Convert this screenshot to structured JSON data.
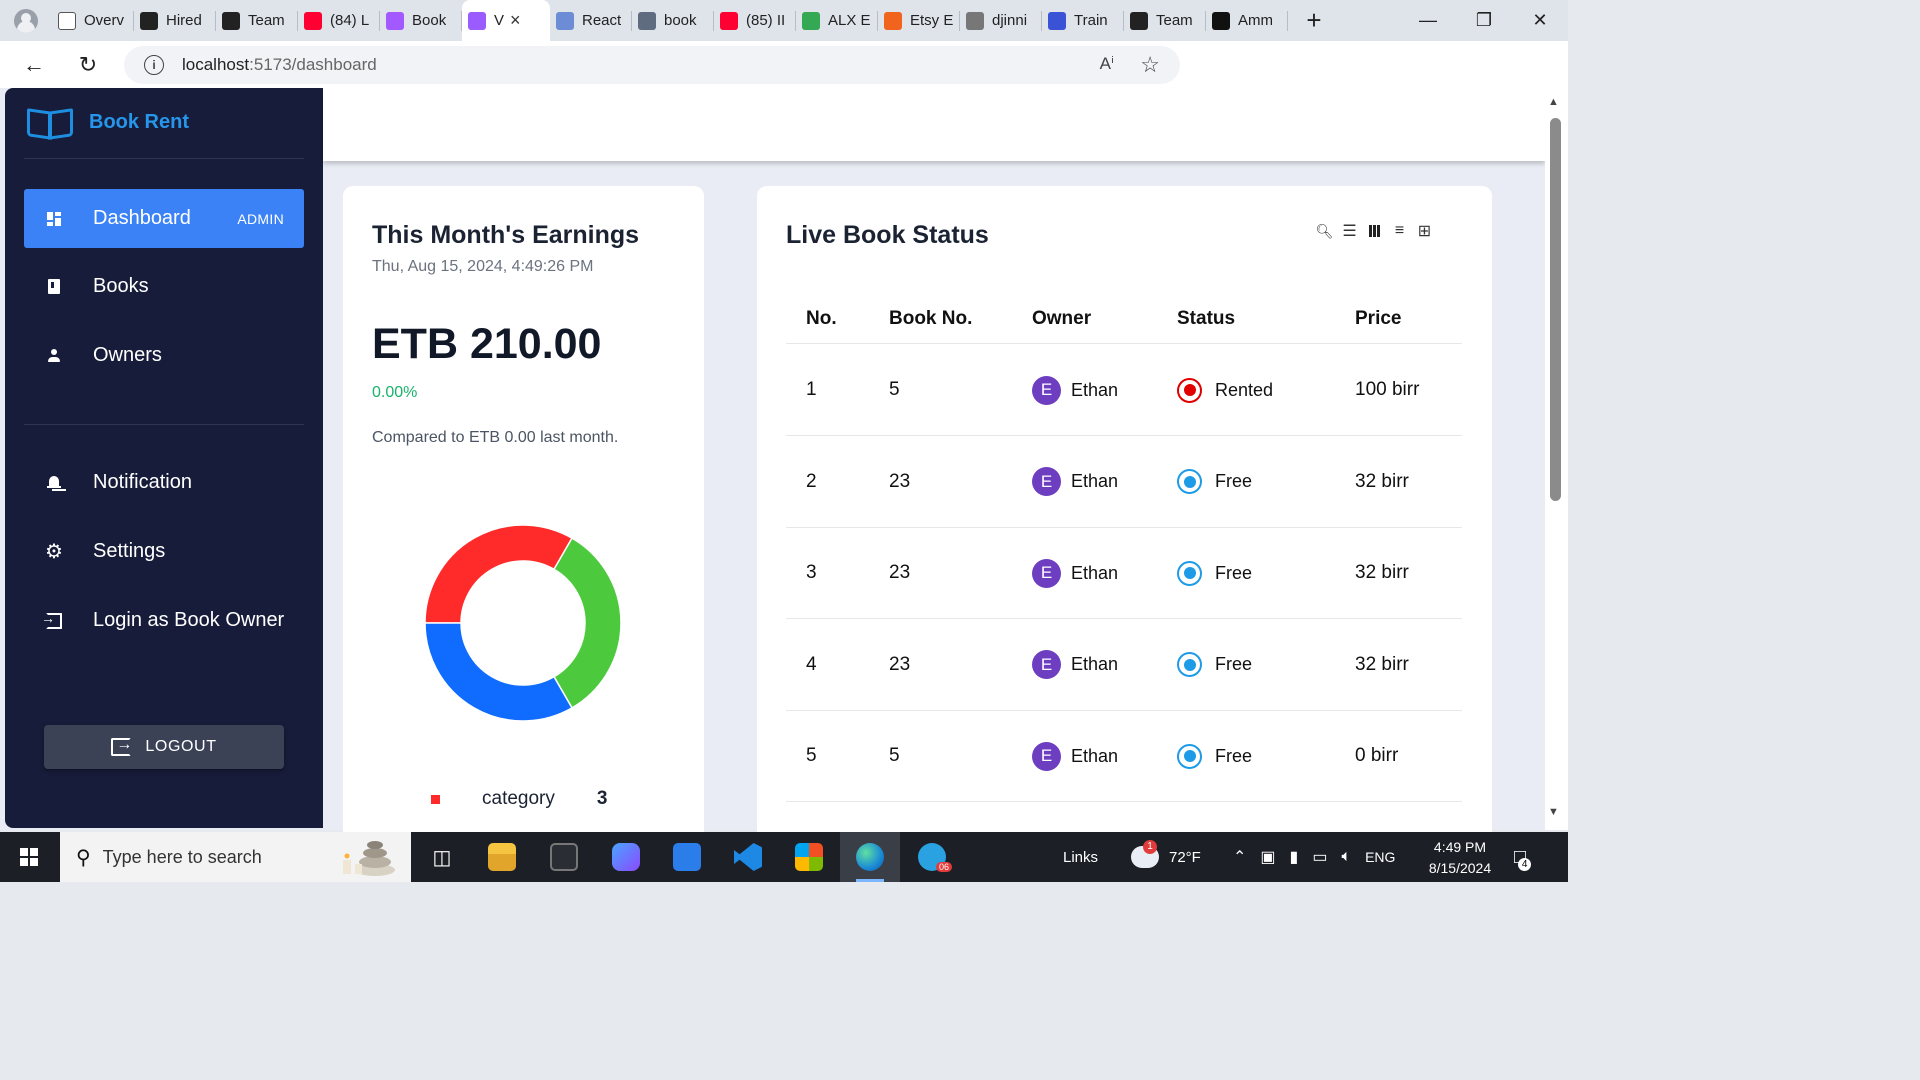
{
  "browser": {
    "tabs": [
      {
        "title": "Overv",
        "icon": "doc-icon",
        "color": "#ffffff"
      },
      {
        "title": "Hired",
        "icon": "openai-icon",
        "color": "#222222"
      },
      {
        "title": "Team",
        "icon": "spark-icon",
        "color": "#222222"
      },
      {
        "title": "(84) L",
        "icon": "youtube-icon",
        "color": "#ff0033"
      },
      {
        "title": "Book",
        "icon": "figma-icon",
        "color": "#a259ff"
      },
      {
        "title": "V",
        "icon": "vite-icon",
        "color": "#9b5cff",
        "active": true
      },
      {
        "title": "React",
        "icon": "mui-icon",
        "color": "#6c8cd5"
      },
      {
        "title": "book",
        "icon": "search-icon",
        "color": "#5f6c80"
      },
      {
        "title": "(85) II",
        "icon": "youtube-icon",
        "color": "#ff0033"
      },
      {
        "title": "ALX E",
        "icon": "maps-icon",
        "color": "#34a853"
      },
      {
        "title": "Etsy E",
        "icon": "etsy-icon",
        "color": "#f1641e"
      },
      {
        "title": "djinni",
        "icon": "doc-icon",
        "color": "#777777"
      },
      {
        "title": "Train",
        "icon": "dj-icon",
        "color": "#3a53d6"
      },
      {
        "title": "Team",
        "icon": "spark-icon",
        "color": "#222222"
      },
      {
        "title": "Amm",
        "icon": "github-icon",
        "color": "#111111"
      }
    ],
    "url_host": "localhost",
    "url_rest": ":5173/dashboard"
  },
  "sidebar": {
    "brand": "Book Rent",
    "items": [
      {
        "label": "Dashboard",
        "badge": "ADMIN",
        "icon": "dashboard-icon",
        "active": true
      },
      {
        "label": "Books",
        "icon": "book-icon"
      },
      {
        "label": "Owners",
        "icon": "person-icon"
      }
    ],
    "secondary_items": [
      {
        "label": "Notification",
        "icon": "bell-icon"
      },
      {
        "label": "Settings",
        "icon": "gear-icon"
      },
      {
        "label": "Login as Book Owner",
        "icon": "login-icon"
      }
    ],
    "logout_label": "LOGOUT"
  },
  "earnings": {
    "title": "This Month's Earnings",
    "date": "Thu, Aug 15, 2024, 4:49:26 PM",
    "amount": "ETB 210.00",
    "change": "0.00%",
    "compare": "Compared to ETB 0.00 last month.",
    "legend_label": "category",
    "legend_value": "3"
  },
  "chart_data": {
    "type": "pie",
    "donut": true,
    "values": [
      1,
      1,
      1
    ],
    "colors": [
      "#ff2a2a",
      "#4cc93d",
      "#0f6cff"
    ],
    "legend": [
      "category"
    ]
  },
  "live_status": {
    "title": "Live Book Status",
    "tool_icons": [
      "search-icon",
      "filter-icon",
      "columns-icon",
      "density-icon",
      "settings-sliders-icon"
    ],
    "headers": [
      "No.",
      "Book No.",
      "Owner",
      "Status",
      "Price"
    ],
    "rows": [
      {
        "no": "1",
        "book_no": "5",
        "owner": "Ethan",
        "initial": "E",
        "status": "Rented",
        "status_color": "#e00000",
        "price": "100 birr"
      },
      {
        "no": "2",
        "book_no": "23",
        "owner": "Ethan",
        "initial": "E",
        "status": "Free",
        "status_color": "#1e9be6",
        "price": "32 birr"
      },
      {
        "no": "3",
        "book_no": "23",
        "owner": "Ethan",
        "initial": "E",
        "status": "Free",
        "status_color": "#1e9be6",
        "price": "32 birr"
      },
      {
        "no": "4",
        "book_no": "23",
        "owner": "Ethan",
        "initial": "E",
        "status": "Free",
        "status_color": "#1e9be6",
        "price": "32 birr"
      },
      {
        "no": "5",
        "book_no": "5",
        "owner": "Ethan",
        "initial": "E",
        "status": "Free",
        "status_color": "#1e9be6",
        "price": "0 birr"
      }
    ]
  },
  "taskbar": {
    "search_placeholder": "Type here to search",
    "links_label": "Links",
    "weather_badge": "1",
    "temperature": "72°F",
    "language": "ENG",
    "time": "4:49 PM",
    "date": "8/15/2024",
    "notification_count": "4",
    "telegram_badge": "06"
  }
}
